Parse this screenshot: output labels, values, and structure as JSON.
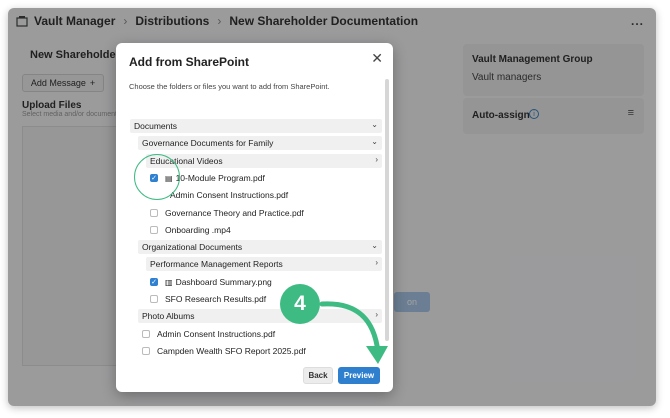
{
  "topbar": {
    "app": "Vault Manager",
    "crumb2": "Distributions",
    "crumb3": "New Shareholder Documentation",
    "more": "..."
  },
  "background": {
    "title": "New Shareholder Do",
    "add_message": "Add Message",
    "upload_title": "Upload Files",
    "upload_sub": "Select media and/or document",
    "right_btn": "on",
    "group_title": "Vault Management Group",
    "group_sub": "Vault managers",
    "auto_assign": "Auto-assign",
    "info": "i",
    "menu": "≡"
  },
  "modal": {
    "title": "Add from SharePoint",
    "close": "✕",
    "description": "Choose the folders or files you want to add from SharePoint.",
    "rows": {
      "documents": "Documents",
      "governance": "Governance Documents for Family",
      "edu_videos": "Educational Videos",
      "file_10module": "10-Module Program.pdf",
      "file_admin1": "Admin Consent Instructions.pdf",
      "file_gov_theory": "Governance Theory and Practice.pdf",
      "file_onboarding": "Onboarding .mp4",
      "org_docs": "Organizational Documents",
      "perf_reports": "Performance Management Reports",
      "file_dashboard": "Dashboard Summary.png",
      "file_sfo": "SFO Research Results.pdf",
      "photo_albums": "Photo Albums",
      "file_admin2": "Admin Consent Instructions.pdf",
      "file_campden": "Campden Wealth SFO Report 2025.pdf"
    },
    "chevrons": {
      "down": "⌄",
      "right": "›"
    },
    "checks": {
      "file_10module": true,
      "file_dashboard": true
    },
    "back": "Back",
    "preview": "Preview"
  },
  "annotation": {
    "step": "4",
    "color": "#3dbb82"
  },
  "colors": {
    "accent": "#2f7fcf"
  }
}
